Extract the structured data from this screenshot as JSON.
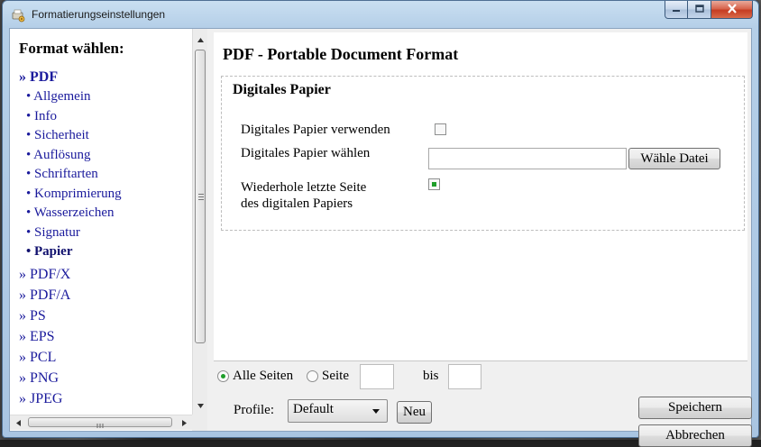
{
  "window": {
    "title": "Formatierungseinstellungen"
  },
  "nav": {
    "heading": "Format wählen:",
    "formats": [
      {
        "label": "» PDF",
        "active": true,
        "items": [
          {
            "label": "• Allgemein"
          },
          {
            "label": "• Info"
          },
          {
            "label": "• Sicherheit"
          },
          {
            "label": "• Auflösung"
          },
          {
            "label": "• Schriftarten"
          },
          {
            "label": "• Komprimierung"
          },
          {
            "label": "• Wasserzeichen"
          },
          {
            "label": "• Signatur"
          },
          {
            "label": "• Papier",
            "active": true
          }
        ]
      },
      {
        "label": "» PDF/X"
      },
      {
        "label": "» PDF/A"
      },
      {
        "label": "» PS"
      },
      {
        "label": "» EPS"
      },
      {
        "label": "» PCL"
      },
      {
        "label": "» PNG"
      },
      {
        "label": "» JPEG"
      }
    ]
  },
  "main": {
    "title": "PDF - Portable Document Format",
    "section": {
      "title": "Digitales Papier",
      "use_label": "Digitales Papier verwenden",
      "use_checked": false,
      "choose_label": "Digitales Papier wählen",
      "file_value": "",
      "choose_button": "Wähle Datei",
      "repeat_label_line1": "Wiederhole letzte Seite",
      "repeat_label_line2": "des digitalen Papiers",
      "repeat_checked": true
    }
  },
  "footer": {
    "all_pages_label": "Alle Seiten",
    "all_pages_selected": true,
    "page_label": "Seite",
    "page_from": "",
    "to_label": "bis",
    "page_to": "",
    "profile_label": "Profile:",
    "profile_value": "Default",
    "new_button": "Neu",
    "save_button": "Speichern",
    "cancel_button": "Abbrechen"
  },
  "icons": {
    "app": "printer-gear-icon",
    "minimize": "minimize-icon",
    "maximize": "maximize-icon",
    "close": "close-icon"
  },
  "colors": {
    "nav_link": "#1a1a9c",
    "checkbox_mark": "#1e9e2a",
    "close_button": "#c53c22"
  }
}
